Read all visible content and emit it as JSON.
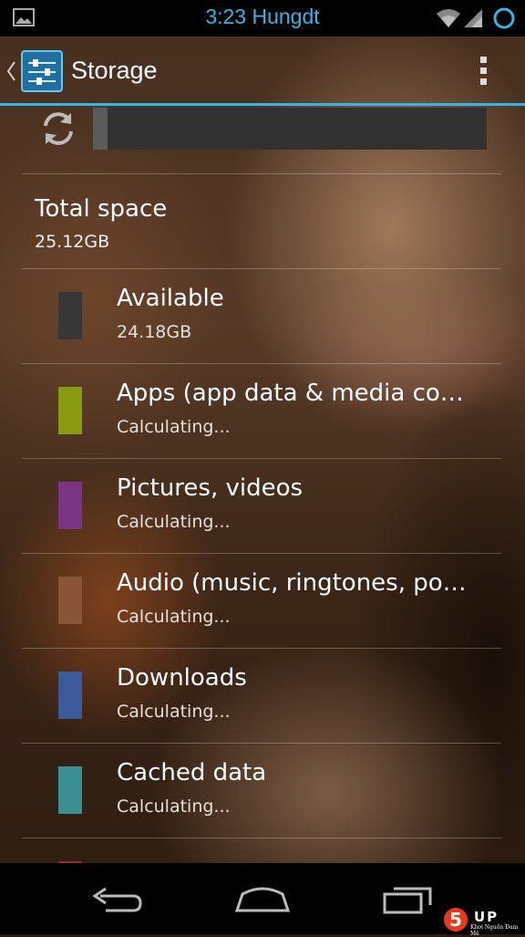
{
  "status_bar": {
    "time_text": "3:23 Hungdt",
    "accent_color": "#33b5e5",
    "icons": [
      "image-notification-icon",
      "wifi-icon",
      "signal-icon",
      "battery-circle-icon"
    ]
  },
  "action_bar": {
    "title": "Storage",
    "app_icon": "settings-sliders-icon",
    "overflow_icon": "overflow-menu-icon"
  },
  "storage": {
    "refresh_icon": "refresh-icon",
    "total": {
      "title": "Total space",
      "value": "25.12GB"
    },
    "categories": [
      {
        "title": "Available",
        "value": "24.18GB",
        "color": "#373737"
      },
      {
        "title": "Apps (app data & media content)",
        "value": "Calculating...",
        "color": "#8a9a10"
      },
      {
        "title": "Pictures, videos",
        "value": "Calculating...",
        "color": "#7a3585"
      },
      {
        "title": "Audio (music, ringtones, podcasts, etc.)",
        "value": "Calculating...",
        "color": "#8a5536"
      },
      {
        "title": "Downloads",
        "value": "Calculating...",
        "color": "#3b5a9a"
      },
      {
        "title": "Cached data",
        "value": "Calculating...",
        "color": "#3a9090"
      },
      {
        "title": "",
        "value": "",
        "color": "#9b2a2a"
      }
    ]
  },
  "nav_bar": {
    "icons": [
      "back-icon",
      "home-icon",
      "recents-icon"
    ]
  },
  "watermark": {
    "logo": "5UP",
    "tagline": "Khơi Nguồn Đam Mê"
  }
}
